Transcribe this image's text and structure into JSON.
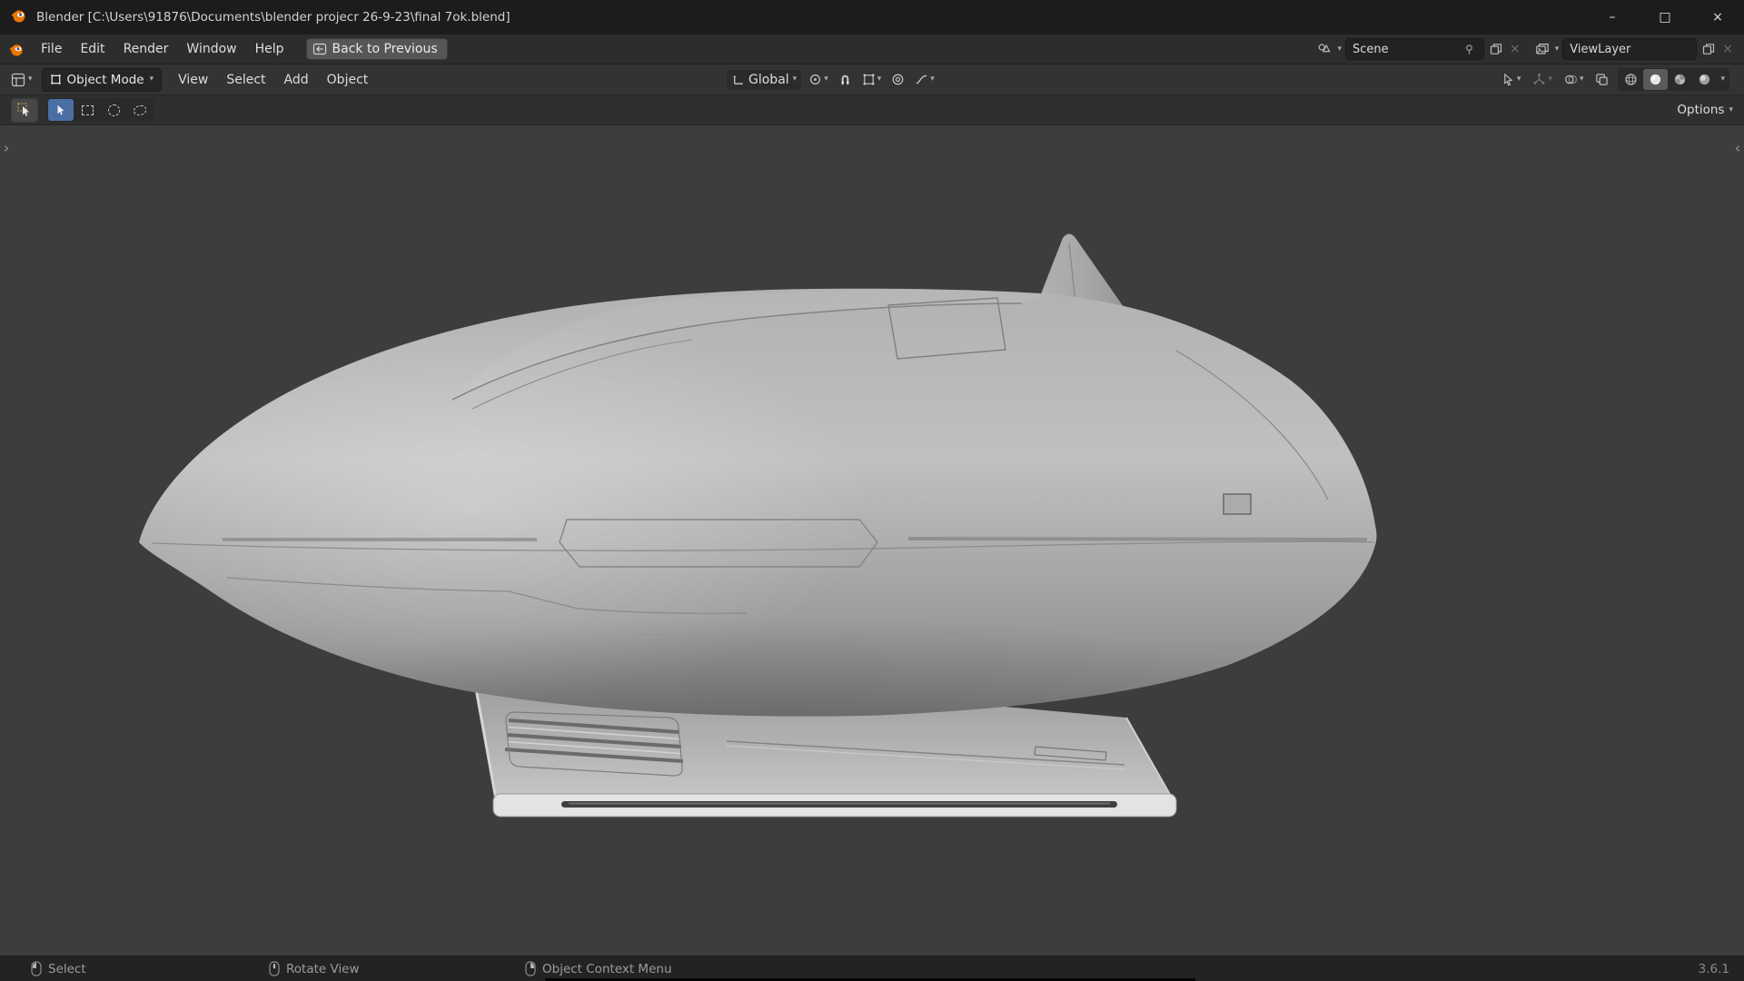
{
  "window": {
    "title": "Blender [C:\\Users\\91876\\Documents\\blender projecr 26-9-23\\final 7ok.blend]",
    "minimize": "–",
    "maximize": "□",
    "close": "×"
  },
  "icons": {
    "chevron_down": "▾",
    "close_x": "×",
    "panel_open_right": "›",
    "panel_open_left": "‹"
  },
  "topbar": {
    "menus": [
      {
        "label": "File"
      },
      {
        "label": "Edit"
      },
      {
        "label": "Render"
      },
      {
        "label": "Window"
      },
      {
        "label": "Help"
      }
    ],
    "back_button": {
      "label": "Back to Previous"
    },
    "scene_selector": {
      "value": "Scene"
    },
    "view_layer_selector": {
      "value": "ViewLayer"
    }
  },
  "viewport_header": {
    "mode_selector": {
      "value": "Object Mode"
    },
    "menus": [
      {
        "label": "View"
      },
      {
        "label": "Select"
      },
      {
        "label": "Add"
      },
      {
        "label": "Object"
      }
    ],
    "transform_orientation": {
      "value": "Global"
    }
  },
  "tool_header": {
    "options_button": {
      "label": "Options"
    }
  },
  "viewport": {
    "model": "spaceship-fuselage-side-view",
    "shading": "solid",
    "background": "#3d3d3d"
  },
  "statusbar": {
    "keymap": [
      {
        "button": "LMB",
        "label": "Select"
      },
      {
        "button": "MMB",
        "label": "Rotate View"
      },
      {
        "button": "RMB",
        "label": "Object Context Menu"
      }
    ],
    "version": "3.6.1"
  },
  "colors": {
    "titlebar": "#1c1c1c",
    "topbar": "#2d2d2d",
    "header": "#333333",
    "viewport": "#3d3d3d",
    "statusbar": "#232323",
    "accent_active": "#4a6fa5",
    "blender_orange": "#ea7600"
  }
}
